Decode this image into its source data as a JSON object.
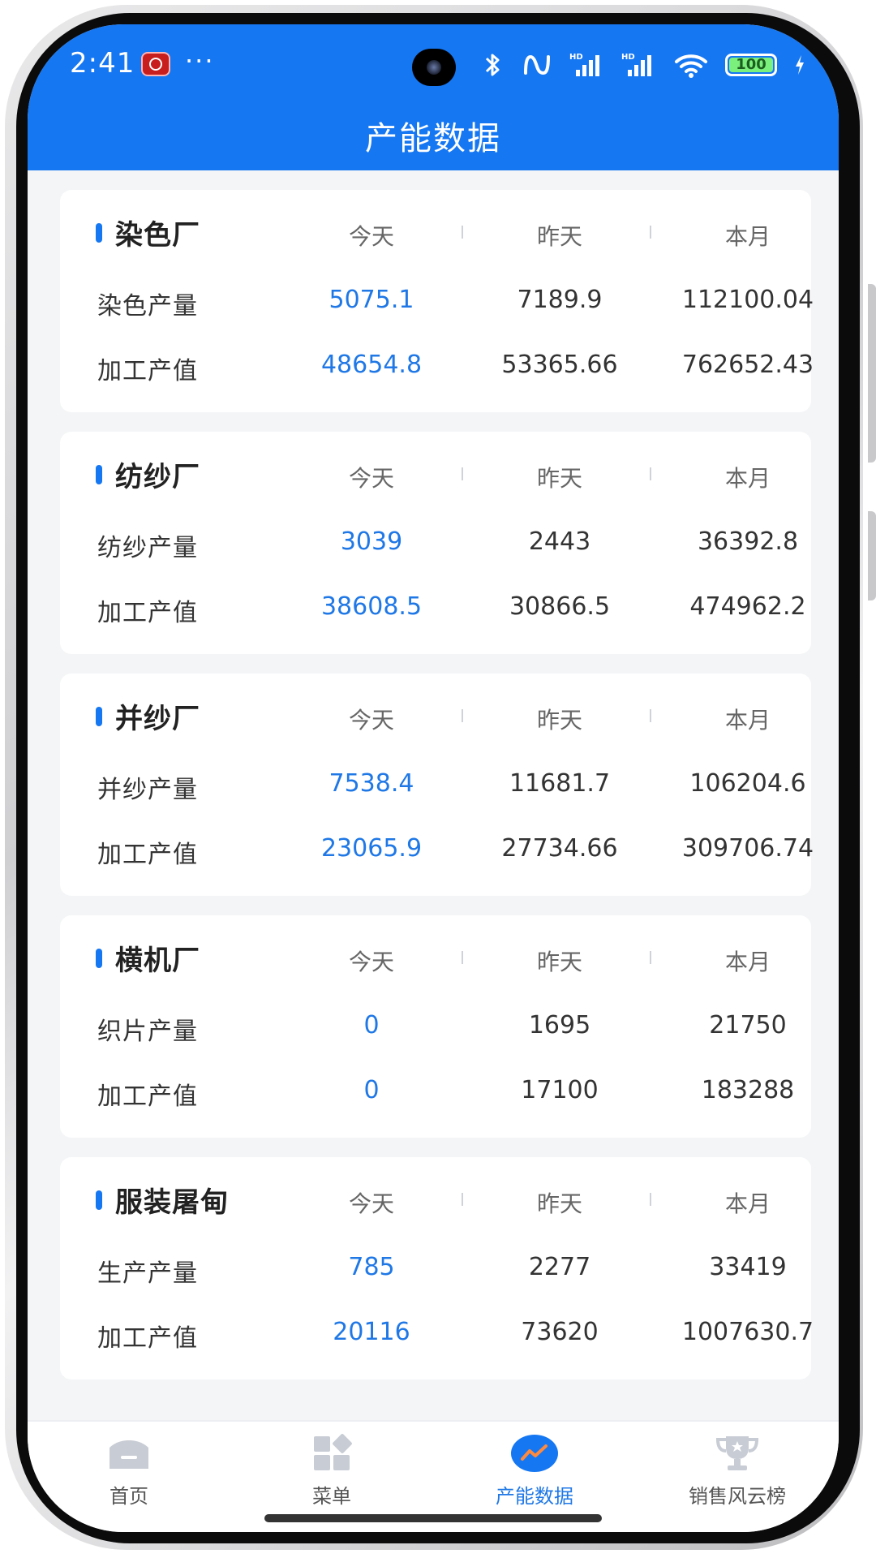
{
  "status_bar": {
    "time": "2:41",
    "more": "···",
    "battery": "100"
  },
  "header": {
    "title": "产能数据"
  },
  "columns": {
    "today": "今天",
    "yesterday": "昨天",
    "month": "本月"
  },
  "cards": [
    {
      "title": "染色厂",
      "rows": [
        {
          "label": "染色产量",
          "today": "5075.1",
          "yesterday": "7189.9",
          "month": "112100.04"
        },
        {
          "label": "加工产值",
          "today": "48654.8",
          "yesterday": "53365.66",
          "month": "762652.43"
        }
      ]
    },
    {
      "title": "纺纱厂",
      "rows": [
        {
          "label": "纺纱产量",
          "today": "3039",
          "yesterday": "2443",
          "month": "36392.8"
        },
        {
          "label": "加工产值",
          "today": "38608.5",
          "yesterday": "30866.5",
          "month": "474962.2"
        }
      ]
    },
    {
      "title": "并纱厂",
      "rows": [
        {
          "label": "并纱产量",
          "today": "7538.4",
          "yesterday": "11681.7",
          "month": "106204.6"
        },
        {
          "label": "加工产值",
          "today": "23065.9",
          "yesterday": "27734.66",
          "month": "309706.74"
        }
      ]
    },
    {
      "title": "横机厂",
      "rows": [
        {
          "label": "织片产量",
          "today": "0",
          "yesterday": "1695",
          "month": "21750"
        },
        {
          "label": "加工产值",
          "today": "0",
          "yesterday": "17100",
          "month": "183288"
        }
      ]
    },
    {
      "title": "服装屠甸",
      "rows": [
        {
          "label": "生产产量",
          "today": "785",
          "yesterday": "2277",
          "month": "33419"
        },
        {
          "label": "加工产值",
          "today": "20116",
          "yesterday": "73620",
          "month": "1007630.7"
        }
      ]
    }
  ],
  "nav": {
    "items": [
      {
        "label": "首页",
        "icon": "home-icon"
      },
      {
        "label": "菜单",
        "icon": "menu-grid-icon"
      },
      {
        "label": "产能数据",
        "icon": "chart-trend-icon"
      },
      {
        "label": "销售风云榜",
        "icon": "trophy-icon"
      }
    ],
    "active": 2
  },
  "colors": {
    "primary": "#1677f2",
    "today_value": "#1f78e6",
    "background": "#f4f5f7"
  }
}
